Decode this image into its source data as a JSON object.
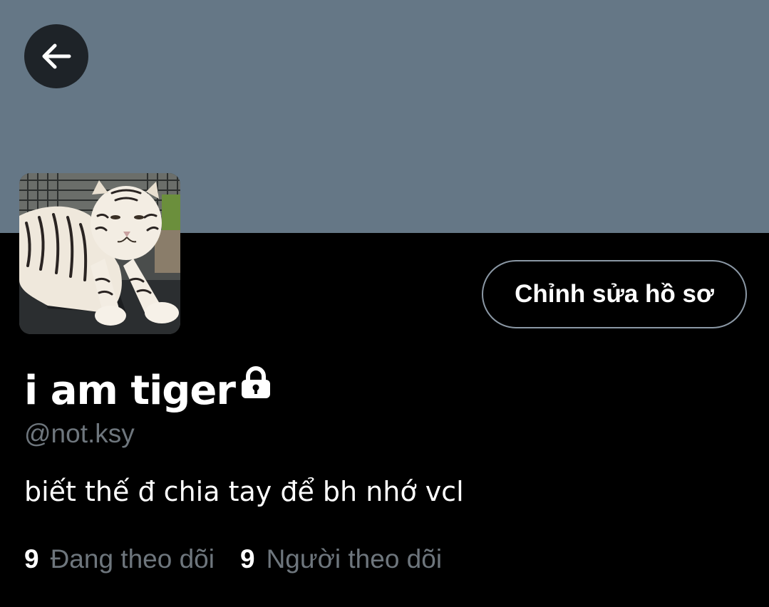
{
  "colors": {
    "banner": "#657786",
    "background": "#000000",
    "secondary_text": "#6e767d",
    "button_border": "#8b98a5"
  },
  "header": {
    "back_icon": "arrow-left-icon"
  },
  "profile": {
    "avatar_alt": "white tiger",
    "edit_button_label": "Chỉnh sửa hồ sơ",
    "display_name": "i am tiger",
    "protected_icon": "lock-icon",
    "handle": "@not.ksy",
    "bio": "biết thế đ chia tay để bh nhớ vcl"
  },
  "stats": {
    "following_count": "9",
    "following_label": "Đang theo dõi",
    "followers_count": "9",
    "followers_label": "Người theo dõi"
  }
}
